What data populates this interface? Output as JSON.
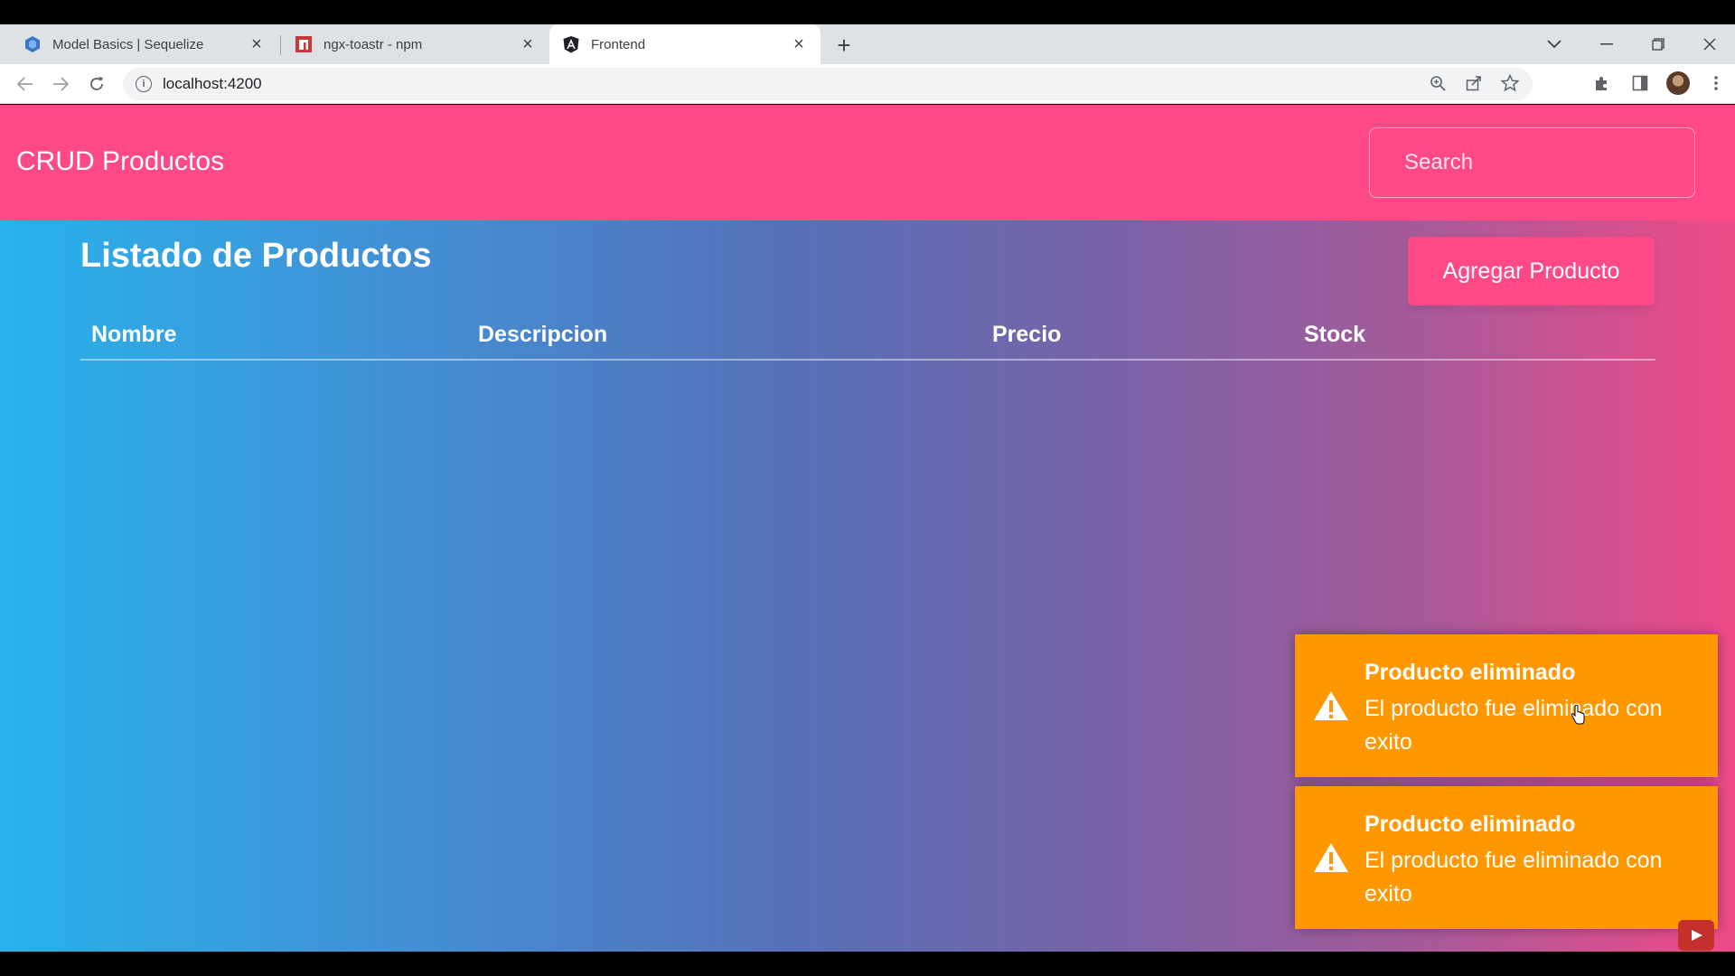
{
  "browser": {
    "tabs": [
      {
        "title": "Model Basics | Sequelize",
        "icon": "sequelize-icon",
        "active": false
      },
      {
        "title": "ngx-toastr - npm",
        "icon": "npm-icon",
        "active": false
      },
      {
        "title": "Frontend",
        "icon": "angular-icon",
        "active": true
      }
    ],
    "new_tab_symbol": "+",
    "url": "localhost:4200"
  },
  "app": {
    "brand": "CRUD Productos",
    "search_placeholder": "Search",
    "heading": "Listado de Productos",
    "add_button": "Agregar Producto",
    "table": {
      "columns": [
        "Nombre",
        "Descripcion",
        "Precio",
        "Stock"
      ],
      "rows": []
    }
  },
  "toasts": [
    {
      "title": "Producto eliminado",
      "message": "El producto fue eliminado con exito",
      "color": "#ff9800",
      "icon": "warning-icon"
    },
    {
      "title": "Producto eliminado",
      "message": "El producto fue eliminado con exito",
      "color": "#ff9800",
      "icon": "warning-icon"
    }
  ],
  "colors": {
    "navbar": "#fd4a86",
    "gradient_start": "#27b2ea",
    "gradient_end": "#ef4a88"
  }
}
